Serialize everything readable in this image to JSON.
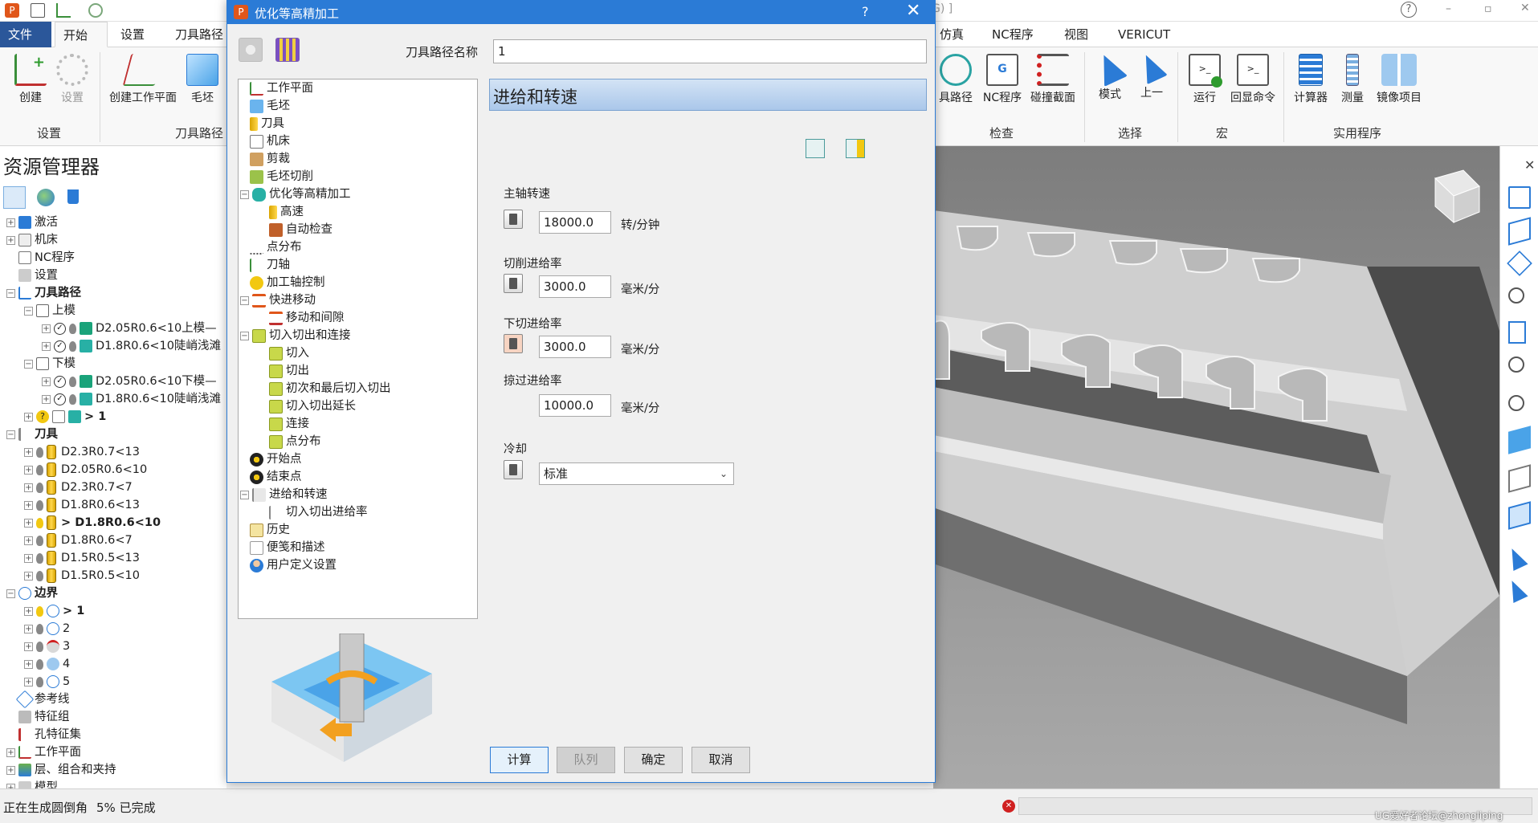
{
  "app": {
    "title_tail": "G) ]",
    "tabs": [
      "文件",
      "开始",
      "设置",
      "刀具路径",
      "仿真",
      "NC程序",
      "视图",
      "VERICUT"
    ],
    "ribbon": {
      "buttons_left": [
        "创建",
        "设置",
        "创建工作平面",
        "毛坯"
      ],
      "groups_left": [
        "设置",
        "刀具路径"
      ],
      "buttons_right": [
        "具路径",
        "NC程序",
        "碰撞截面",
        "模式",
        "上一",
        "运行",
        "回显命令",
        "计算器",
        "测量",
        "镜像项目"
      ],
      "groups_right": [
        "检查",
        "选择",
        "宏",
        "实用程序"
      ]
    }
  },
  "explorer": {
    "title": "资源管理器",
    "items": [
      {
        "label": "激活",
        "bold": false
      },
      {
        "label": "机床",
        "bold": false
      },
      {
        "label": "NC程序",
        "bold": false
      },
      {
        "label": "设置",
        "bold": false
      },
      {
        "label": "刀具路径",
        "bold": true
      },
      {
        "label": "上模",
        "bold": false
      },
      {
        "label": "D2.05R0.6<10上模—",
        "bold": false
      },
      {
        "label": "D1.8R0.6<10陡峭浅滩",
        "bold": false
      },
      {
        "label": "下模",
        "bold": false
      },
      {
        "label": "D2.05R0.6<10下模—",
        "bold": false
      },
      {
        "label": "D1.8R0.6<10陡峭浅滩",
        "bold": false
      },
      {
        "label": "> 1",
        "bold": true
      },
      {
        "label": "刀具",
        "bold": true
      },
      {
        "label": "D2.3R0.7<13",
        "bold": false
      },
      {
        "label": "D2.05R0.6<10",
        "bold": false
      },
      {
        "label": "D2.3R0.7<7",
        "bold": false
      },
      {
        "label": "D1.8R0.6<13",
        "bold": false
      },
      {
        "label": "> D1.8R0.6<10",
        "bold": true
      },
      {
        "label": "D1.8R0.6<7",
        "bold": false
      },
      {
        "label": "D1.5R0.5<13",
        "bold": false
      },
      {
        "label": "D1.5R0.5<10",
        "bold": false
      },
      {
        "label": "边界",
        "bold": true
      },
      {
        "label": "> 1",
        "bold": true
      },
      {
        "label": "2",
        "bold": false
      },
      {
        "label": "3",
        "bold": false
      },
      {
        "label": "4",
        "bold": false
      },
      {
        "label": "5",
        "bold": false
      },
      {
        "label": "参考线",
        "bold": false
      },
      {
        "label": "特征组",
        "bold": false
      },
      {
        "label": "孔特征集",
        "bold": false
      },
      {
        "label": "工作平面",
        "bold": false
      },
      {
        "label": "层、组合和夹持",
        "bold": false
      },
      {
        "label": "模型",
        "bold": false
      }
    ]
  },
  "dialog": {
    "title": "优化等高精加工",
    "help": "?",
    "close": "✕",
    "toolpath_name_label": "刀具路径名称",
    "toolpath_name_value": "1",
    "section_title": "进给和转速",
    "tree": [
      "工作平面",
      "毛坯",
      "刀具",
      "机床",
      "剪裁",
      "毛坯切削",
      "优化等高精加工",
      "高速",
      "自动检查",
      "点分布",
      "刀轴",
      "加工轴控制",
      "快进移动",
      "移动和间隙",
      "切入切出和连接",
      "切入",
      "切出",
      "初次和最后切入切出",
      "切入切出延长",
      "连接",
      "点分布",
      "开始点",
      "结束点",
      "进给和转速",
      "切入切出进给率",
      "历史",
      "便笺和描述",
      "用户定义设置"
    ],
    "spindle": {
      "label": "主轴转速",
      "value": "18000.0",
      "unit": "转/分钟"
    },
    "cutting_feed": {
      "label": "切削进给率",
      "value": "3000.0",
      "unit": "毫米/分"
    },
    "plunge_feed": {
      "label": "下切进给率",
      "value": "3000.0",
      "unit": "毫米/分"
    },
    "skim_feed": {
      "label": "掠过进给率",
      "value": "10000.0",
      "unit": "毫米/分"
    },
    "coolant": {
      "label": "冷却",
      "value": "标准"
    },
    "buttons": {
      "calculate": "计算",
      "queue": "队列",
      "ok": "确定",
      "cancel": "取消"
    }
  },
  "status": {
    "text": "正在生成圆倒角",
    "progress": "5% 已完成",
    "watermark": "UG爱好者论坛@zhongliping"
  },
  "colors": {
    "accent": "#2b7bd6",
    "file_tab": "#2b579a",
    "section_header": "#bcd3ee"
  }
}
